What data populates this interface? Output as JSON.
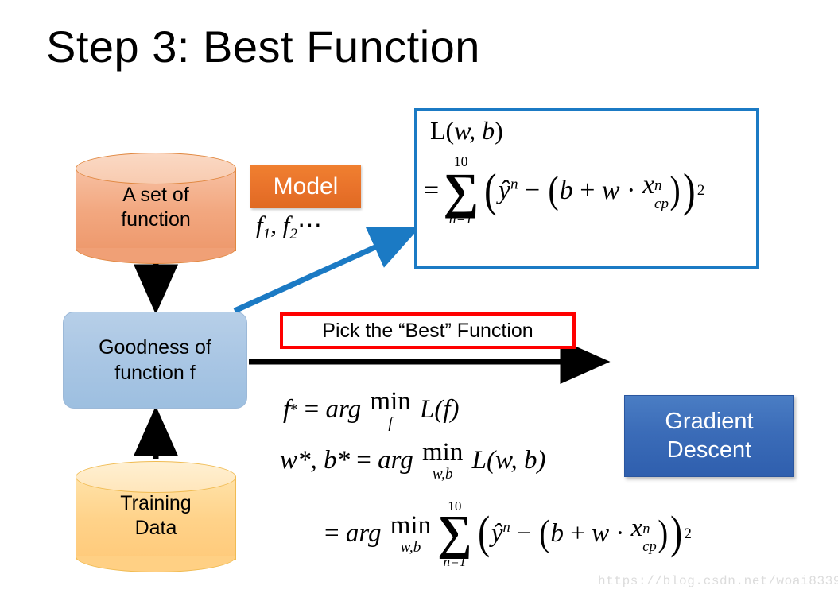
{
  "slide": {
    "title": "Step 3: Best Function",
    "watermark": "https://blog.csdn.net/woai8339",
    "background_color": "#ffffff"
  },
  "flow": {
    "function_set": {
      "line1": "A set of",
      "line2": "function",
      "shape": "cylinder",
      "fill_color": "#f2a77f",
      "border_color": "#e0873f"
    },
    "goodness": {
      "line1": "Goodness of",
      "line2": "function f",
      "shape": "rounded-rectangle",
      "fill_color": "#a9c6e4",
      "border_color": "#9cb9d8"
    },
    "training_data": {
      "line1": "Training",
      "line2": "Data",
      "shape": "cylinder",
      "fill_color": "#ffd289",
      "border_color": "#f0bb52"
    }
  },
  "model": {
    "badge_label": "Model",
    "badge_color": "#e8712a",
    "badge_text_color": "#ffffff",
    "function_list": "f₁, f₂ ⋯",
    "f_items": [
      "f",
      "1",
      "f",
      "2"
    ],
    "ellipsis": "⋯"
  },
  "loss_box": {
    "border_color": "#1b7ac4",
    "line1_lhs": "L(",
    "line1_vars": "w, b",
    "line1_rhs": ")",
    "equals": "=",
    "sum_upper": "10",
    "sum_lower": "n=1",
    "sum_symbol": "∑",
    "y_hat": "ŷ",
    "y_hat_sup": "n",
    "minus": "−",
    "b": "b",
    "plus": "+",
    "w": "w",
    "dot": "·",
    "x": "x",
    "x_sub": "cp",
    "x_sup": "n",
    "outer_exponent": "2",
    "plain_text": "L(w, b) = ∑(n=1 to 10) (ŷⁿ − (b + w · xⁿ_cp))²"
  },
  "pick": {
    "label": "Pick the “Best” Function",
    "border_color": "#ff0000"
  },
  "gradient_descent": {
    "line1": "Gradient",
    "line2": "Descent",
    "fill_color": "#3b6cb8",
    "text_color": "#ffffff"
  },
  "equations": {
    "eq1": {
      "lhs_var": "f",
      "lhs_star": "*",
      "equals": "=",
      "arg": "arg",
      "min": "min",
      "under": "f",
      "loss": "L(f)",
      "plain_text": "f* = arg min_f L(f)"
    },
    "eq2": {
      "lhs": "w*, b*",
      "equals": "=",
      "arg": "arg",
      "min": "min",
      "under": "w,b",
      "loss": "L(w, b)",
      "plain_text": "w*, b* = arg min_{w,b} L(w, b)"
    },
    "eq3": {
      "equals": "=",
      "arg": "arg",
      "min": "min",
      "under": "w,b",
      "sum_upper": "10",
      "sum_lower": "n=1",
      "sum_symbol": "∑",
      "y_hat": "ŷ",
      "y_hat_sup": "n",
      "minus": "−",
      "b": "b",
      "plus": "+",
      "w": "w",
      "dot": "·",
      "x": "x",
      "x_sub": "cp",
      "x_sup": "n",
      "outer_exponent": "2",
      "plain_text": "= arg min_{w,b} ∑(n=1 to 10) (ŷⁿ − (b + w · xⁿ_cp))²"
    }
  },
  "arrows": {
    "down_arrow_color": "#000000",
    "up_arrow_color": "#000000",
    "right_arrow_color": "#000000",
    "blue_arrow_color": "#1b7ac4"
  }
}
